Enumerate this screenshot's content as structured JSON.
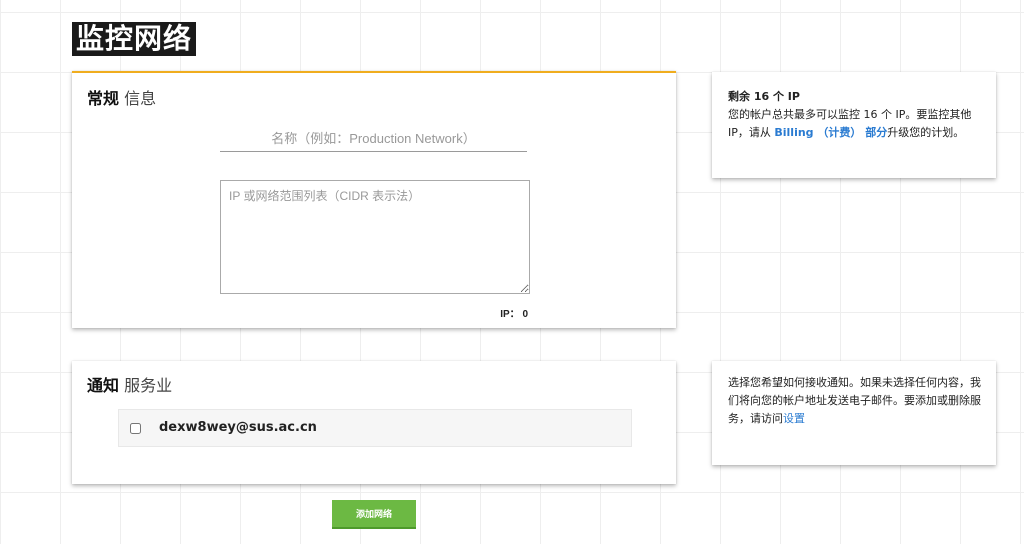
{
  "page": {
    "title": "监控网络"
  },
  "general": {
    "title_bold": "常规",
    "title_light": "信息",
    "name_placeholder": "名称（例如：Production Network）",
    "ips_placeholder": "IP 或网络范围列表（CIDR 表示法）",
    "ip_count_label": "IP：",
    "ip_count_value": "0"
  },
  "remaining": {
    "heading": "剩余 16 个 IP",
    "text_before": "您的帐户总共最多可以监控 16 个 IP。要监控其他 IP，请从 ",
    "link": "Billing （计费） 部分",
    "text_after": "升级您的计划。"
  },
  "notify": {
    "title_bold": "通知",
    "title_light": "服务业",
    "services": [
      {
        "email": "dexw8wey@sus.ac.cn",
        "checked": false
      }
    ]
  },
  "notify_side": {
    "text": "选择您希望如何接收通知。如果未选择任何内容，我们将向您的帐户地址发送电子邮件。要添加或删除服务，请访问",
    "link": "设置"
  },
  "actions": {
    "add_label": "添加网络"
  },
  "colors": {
    "accent": "#f0ad1e",
    "button": "#6cb943",
    "link": "#2a7bd1"
  }
}
